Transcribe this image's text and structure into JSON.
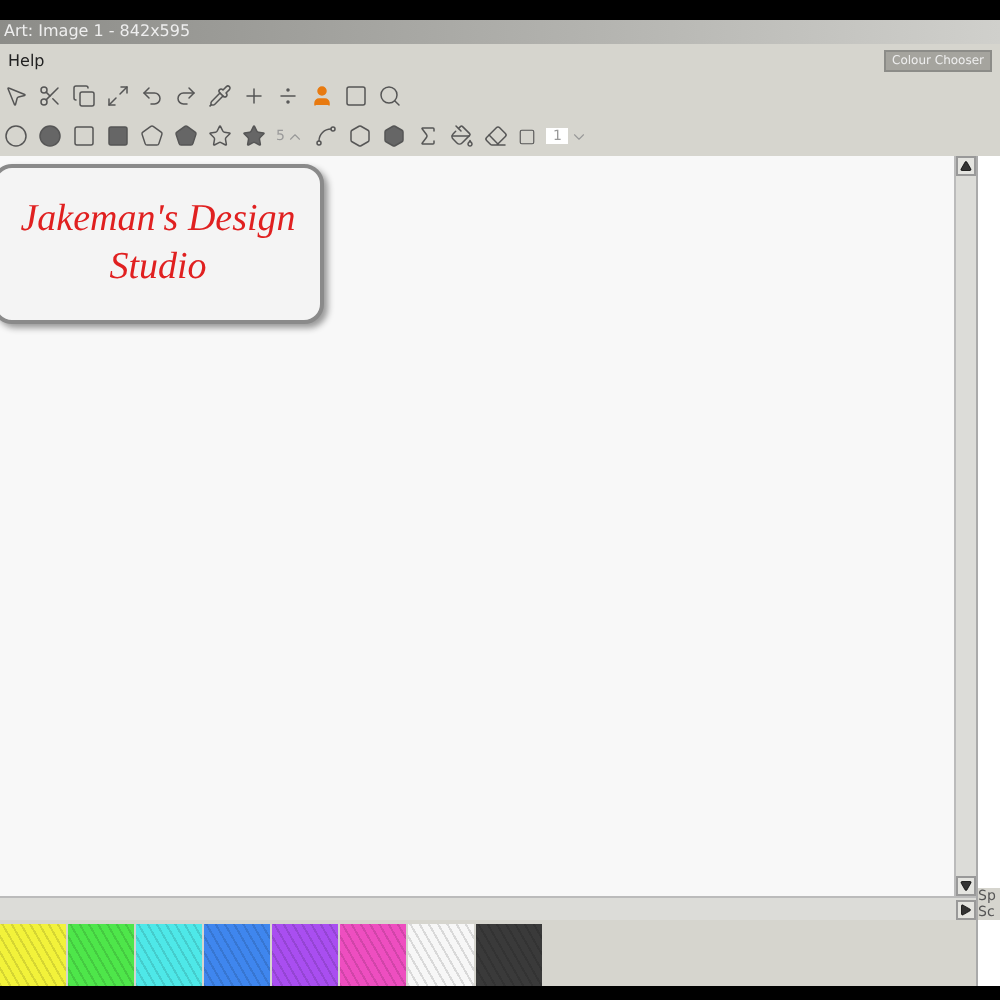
{
  "window": {
    "title": "Art: Image 1 - 842x595"
  },
  "menu": [
    {
      "label": "Help"
    }
  ],
  "colour_button": {
    "label": "Colour Chooser"
  },
  "star_points": {
    "value": "5"
  },
  "line_width": {
    "value": "1"
  },
  "canvas": {
    "logo_lines": [
      "Jakeman's Design",
      "Studio"
    ]
  },
  "side_panel": {
    "labels": [
      "Sp",
      "Sc"
    ]
  },
  "palette": [
    {
      "color": "#f2f23a"
    },
    {
      "color": "#4ee64a"
    },
    {
      "color": "#4ee8e8"
    },
    {
      "color": "#3f86ee"
    },
    {
      "color": "#a94ef0"
    },
    {
      "color": "#ee4ec0"
    },
    {
      "color": "#f7f7f7"
    },
    {
      "color": "#3a3a3a"
    }
  ]
}
